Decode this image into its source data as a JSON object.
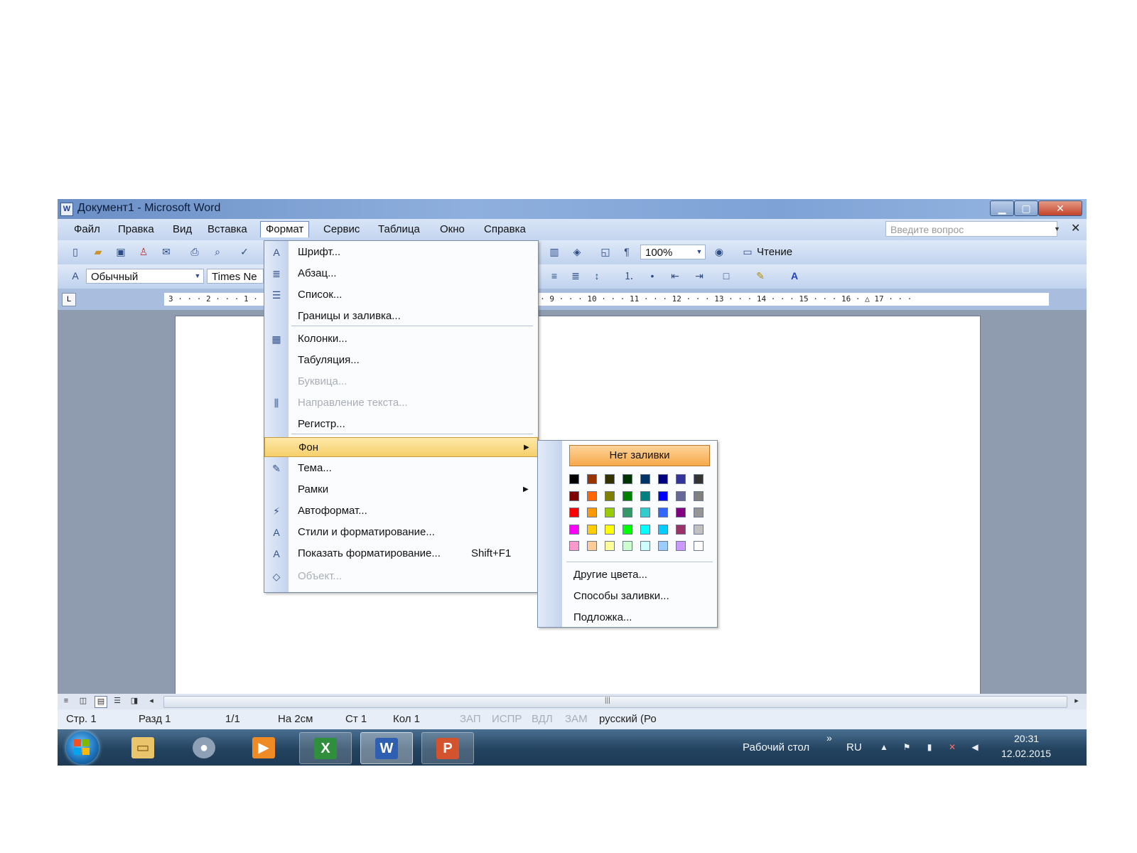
{
  "window": {
    "title": "Документ1 - Microsoft Word",
    "controls": {
      "minimize": "▁",
      "maximize": "▢",
      "close": "✕"
    }
  },
  "menubar": {
    "items": [
      "Файл",
      "Правка",
      "Вид",
      "Вставка",
      "Формат",
      "Сервис",
      "Таблица",
      "Окно",
      "Справка"
    ],
    "active": "Формат",
    "help_placeholder": "Введите вопрос",
    "help_close": "✕"
  },
  "toolbar": {
    "zoom": "100%",
    "reading": "Чтение",
    "style": "Обычный",
    "font": "Times Ne"
  },
  "ruler": {
    "numbers": "3 · · · 2 · · · 1 ·                                            · 7 · · · 8 · · · 9 · · · 10 · · · 11 · · · 12 · · · 13 · · · 14 · · · 15 · · · 16 · △ 17 · · ·"
  },
  "format_menu": {
    "items": [
      {
        "label": "Шрифт...",
        "icon": "font-icon",
        "glyph": "A",
        "enabled": true
      },
      {
        "label": "Абзац...",
        "icon": "paragraph-icon",
        "glyph": "≣",
        "enabled": true
      },
      {
        "label": "Список...",
        "icon": "list-icon",
        "glyph": "☰",
        "enabled": true
      },
      {
        "label": "Границы и заливка...",
        "icon": "",
        "glyph": "",
        "enabled": true
      },
      {
        "label": "Колонки...",
        "icon": "columns-icon",
        "glyph": "▦",
        "enabled": true
      },
      {
        "label": "Табуляция...",
        "icon": "",
        "glyph": "",
        "enabled": true
      },
      {
        "label": "Буквица...",
        "icon": "",
        "glyph": "",
        "enabled": false
      },
      {
        "label": "Направление текста...",
        "icon": "text-direction-icon",
        "glyph": "⫼",
        "enabled": false
      },
      {
        "label": "Регистр...",
        "icon": "",
        "glyph": "",
        "enabled": true
      },
      {
        "label": "Фон",
        "icon": "",
        "glyph": "",
        "enabled": true,
        "submenu": true,
        "highlighted": true
      },
      {
        "label": "Тема...",
        "icon": "theme-icon",
        "glyph": "✎",
        "enabled": true
      },
      {
        "label": "Рамки",
        "icon": "",
        "glyph": "",
        "enabled": true,
        "submenu": true
      },
      {
        "label": "Автоформат...",
        "icon": "autoformat-icon",
        "glyph": "⚡",
        "enabled": true
      },
      {
        "label": "Стили и форматирование...",
        "icon": "styles-icon",
        "glyph": "A",
        "enabled": true
      },
      {
        "label": "Показать форматирование...",
        "icon": "reveal-formatting-icon",
        "glyph": "A",
        "enabled": true,
        "shortcut": "Shift+F1"
      },
      {
        "label": "Объект...",
        "icon": "object-icon",
        "glyph": "◇",
        "enabled": false
      }
    ]
  },
  "background_submenu": {
    "no_fill": "Нет заливки",
    "colors": [
      [
        "#000000",
        "#993300",
        "#333300",
        "#003300",
        "#003366",
        "#000080",
        "#333399",
        "#333333"
      ],
      [
        "#800000",
        "#FF6600",
        "#808000",
        "#008000",
        "#008080",
        "#0000FF",
        "#666699",
        "#808080"
      ],
      [
        "#FF0000",
        "#FF9900",
        "#99CC00",
        "#339966",
        "#33CCCC",
        "#3366FF",
        "#800080",
        "#969696"
      ],
      [
        "#FF00FF",
        "#FFCC00",
        "#FFFF00",
        "#00FF00",
        "#00FFFF",
        "#00CCFF",
        "#993366",
        "#C0C0C0"
      ],
      [
        "#FF99CC",
        "#FFCC99",
        "#FFFF99",
        "#CCFFCC",
        "#CCFFFF",
        "#99CCFF",
        "#CC99FF",
        "#FFFFFF"
      ]
    ],
    "items": [
      "Другие цвета...",
      "Способы заливки...",
      "Подложка..."
    ]
  },
  "statusbar": {
    "page": "Стр. 1",
    "section": "Разд 1",
    "pages": "1/1",
    "at": "На 2см",
    "line": "Ст 1",
    "col": "Кол 1",
    "rec": "ЗАП",
    "trk": "ИСПР",
    "ext": "ВДЛ",
    "ovr": "ЗАМ",
    "language": "русский (Ро"
  },
  "taskbar": {
    "desktop": "Рабочий стол",
    "chevron": "»",
    "lang": "RU",
    "time": "20:31",
    "date": "12.02.2015",
    "apps": [
      {
        "name": "explorer-icon",
        "color": "#e9c46a"
      },
      {
        "name": "media-center-icon",
        "color": "#8da0b5"
      },
      {
        "name": "media-player-icon",
        "color": "#f08a24"
      },
      {
        "name": "excel-icon",
        "color": "#2f8f3c"
      },
      {
        "name": "word-icon",
        "color": "#2f5fb3"
      },
      {
        "name": "powerpoint-icon",
        "color": "#d2532e"
      }
    ]
  }
}
